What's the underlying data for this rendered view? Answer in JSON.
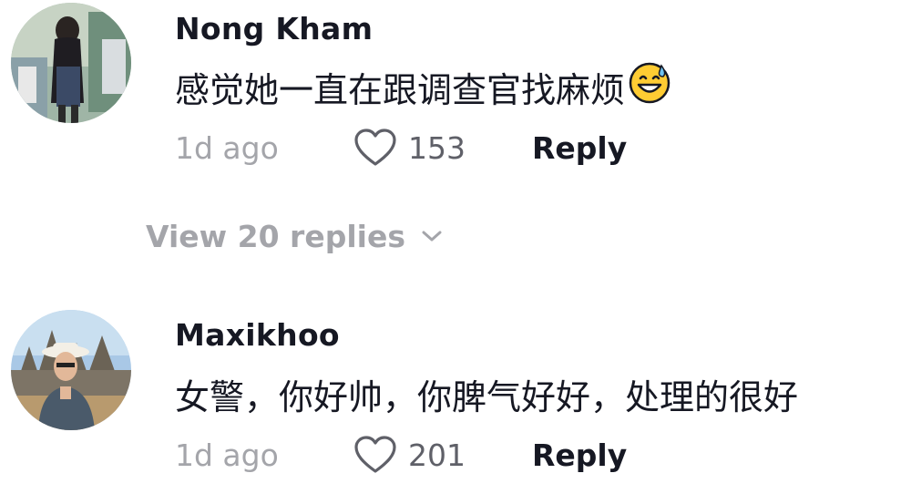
{
  "comments": [
    {
      "username": "Nong Kham",
      "text": "感觉她一直在跟调查官找麻烦",
      "emoji": "grinning-sweat-emoji",
      "time": "1d ago",
      "likes": "153",
      "reply_label": "Reply"
    },
    {
      "username": "Maxikhoo",
      "text": "女警，你好帅，你脾气好好，处理的很好",
      "time": "1d ago",
      "likes": "201",
      "reply_label": "Reply"
    }
  ],
  "view_replies": {
    "label": "View 20 replies"
  },
  "colors": {
    "primary_text": "#161823",
    "secondary_text": "#a4a5aa",
    "like_count": "#5f6068"
  }
}
